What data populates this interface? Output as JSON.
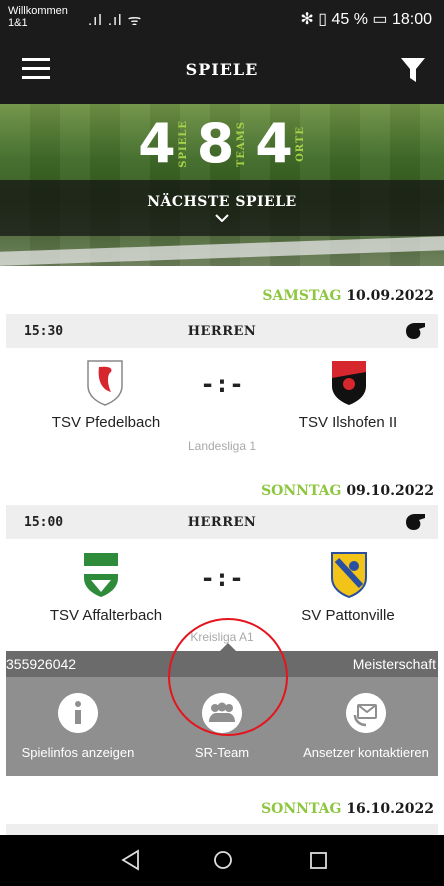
{
  "status_bar": {
    "carrier_line1": "Willkommen",
    "carrier_line2": "1&1",
    "signal": ".ıl .ıl ᯤ",
    "right": "✻ ▯ 45 % ▭ 18:00"
  },
  "app_bar": {
    "title": "SPIELE",
    "menu_icon": "hamburger-icon",
    "filter_icon": "filter-icon"
  },
  "hero": {
    "stats": [
      {
        "number": "4",
        "label": "SPIELE"
      },
      {
        "number": "8",
        "label": "TEAMS"
      },
      {
        "number": "4",
        "label": "ORTE"
      }
    ],
    "next_games_label": "NÄCHSTE SPIELE"
  },
  "matches": [
    {
      "day_name": "SAMSTAG",
      "day_date": "10.09.2022",
      "time": "15:30",
      "category": "HERREN",
      "score": "-:-",
      "home": "TSV Pfedelbach",
      "away": "TSV Ilshofen II",
      "league": "Landesliga 1"
    },
    {
      "day_name": "SONNTAG",
      "day_date": "09.10.2022",
      "time": "15:00",
      "category": "HERREN",
      "score": "-:-",
      "home": "TSV Affalterbach",
      "away": "SV Pattonville",
      "league": "Kreisliga A1"
    },
    {
      "day_name": "SONNTAG",
      "day_date": "16.10.2022"
    }
  ],
  "popup": {
    "match_id": "355926042",
    "competition": "Meisterschaft",
    "actions": [
      {
        "label": "Spielinfos anzeigen",
        "icon": "info-icon"
      },
      {
        "label": "SR-Team",
        "icon": "group-icon"
      },
      {
        "label": "Ansetzer kontaktieren",
        "icon": "mail-phone-icon"
      }
    ]
  },
  "colors": {
    "accent_green": "#8dc63f",
    "bar_dark": "#1b1b1b",
    "annotation_red": "#e4151d"
  }
}
